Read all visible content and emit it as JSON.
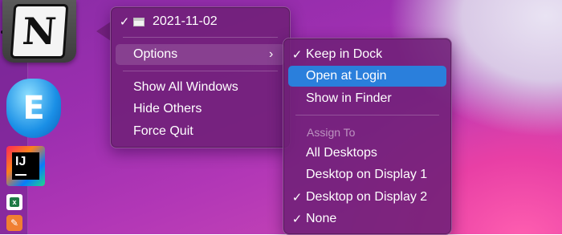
{
  "main_menu": {
    "window_date": "2021-11-02",
    "options_label": "Options",
    "show_all_windows": "Show All Windows",
    "hide_others": "Hide Others",
    "force_quit": "Force Quit"
  },
  "sub_menu": {
    "keep_in_dock": "Keep in Dock",
    "open_at_login": "Open at Login",
    "show_in_finder": "Show in Finder",
    "assign_to_title": "Assign To",
    "all_desktops": "All Desktops",
    "desktop_display_1": "Desktop on Display 1",
    "desktop_display_2": "Desktop on Display 2",
    "none": "None"
  },
  "glyphs": {
    "check": "✓",
    "chevron": "›",
    "notion_letter": "N",
    "ij_text": "IJ",
    "excel_letter": "x",
    "pencil": "✎",
    "lantern_letter": "E"
  },
  "colors": {
    "highlight": "#2a7fdc",
    "menu_bg": "#702078"
  }
}
